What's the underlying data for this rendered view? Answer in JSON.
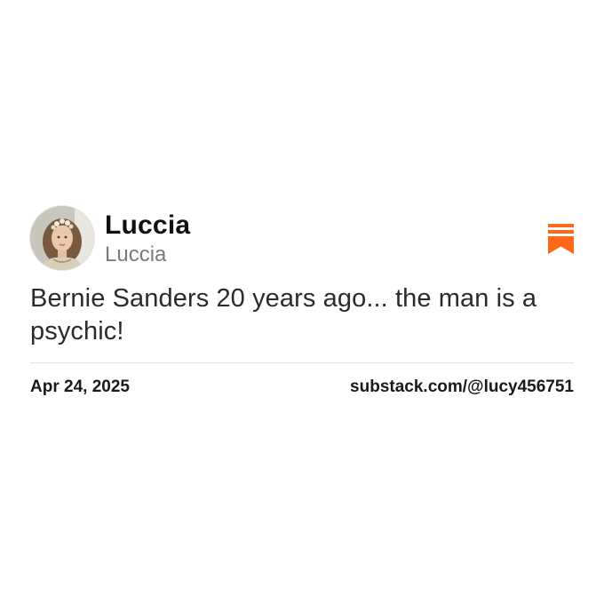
{
  "post": {
    "author": {
      "display_name": "Luccia",
      "handle": "Luccia",
      "avatar_icon": "avatar-portrait"
    },
    "text": "Bernie Sanders 20 years ago... the man is a psychic!",
    "date": "Apr 24, 2025",
    "source_link": "substack.com/@lucy456751"
  },
  "brand": {
    "logo_icon": "substack-logo-icon",
    "accent_color": "#FF6719"
  }
}
